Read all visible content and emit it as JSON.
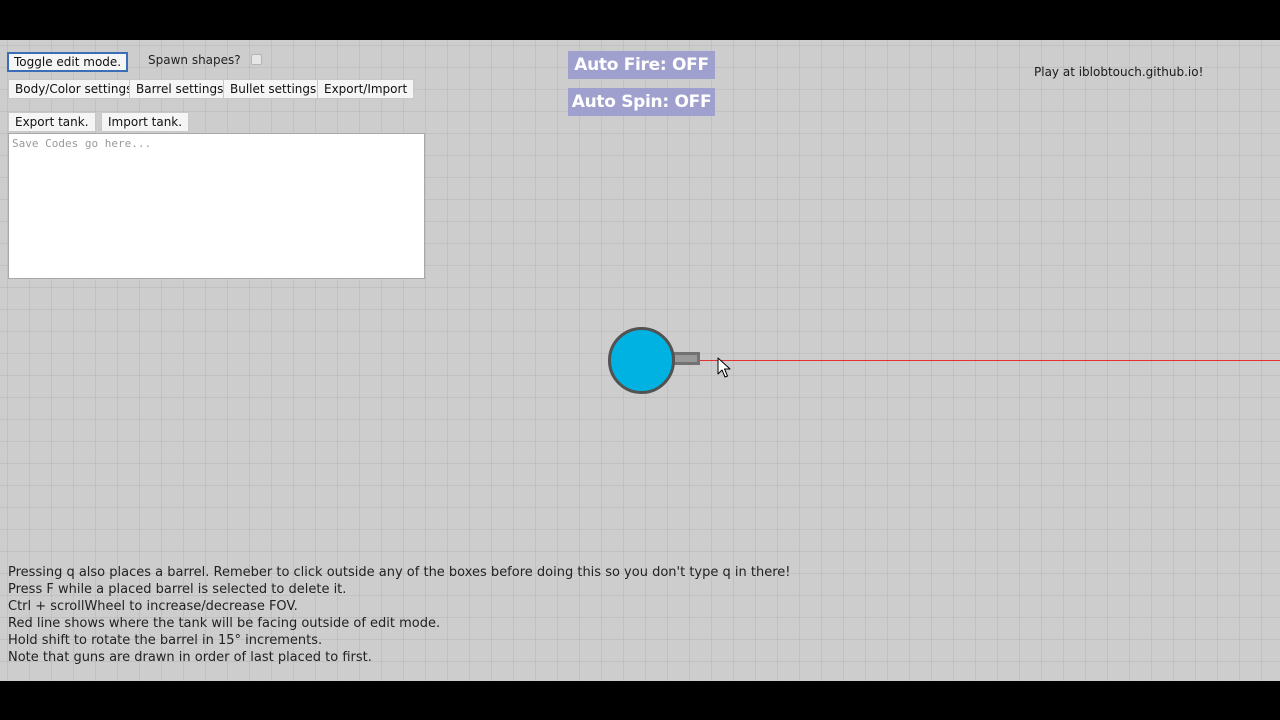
{
  "buttons": {
    "toggle_edit": "Toggle edit mode.",
    "body_color": "Body/Color settings",
    "barrel": "Barrel settings",
    "bullet": "Bullet settings",
    "export_import": "Export/Import",
    "export_tank": "Export tank.",
    "import_tank": "Import tank."
  },
  "spawn_shapes": {
    "label": "Spawn shapes?",
    "checked": false
  },
  "save_codes": {
    "placeholder": "Save Codes go here...",
    "value": ""
  },
  "toggles": {
    "auto_fire": "Auto Fire: OFF",
    "auto_spin": "Auto Spin: OFF"
  },
  "play_link": "Play at iblobtouch.github.io!",
  "instructions": [
    "Pressing q also places a barrel. Remeber to click outside any of the boxes before doing this so you don't type q in there!",
    "Press F while a placed barrel is selected to delete it.",
    "Ctrl + scrollWheel to increase/decrease FOV.",
    "Red line shows where the tank will be facing outside of edit mode.",
    "Hold shift to rotate the barrel in 15° increments.",
    "Note that guns are drawn in order of last placed to first."
  ],
  "colors": {
    "background": "#cdcdcd",
    "tank_body": "#00b2e1",
    "tank_outline": "#525252",
    "barrel_fill": "#999999",
    "barrel_outline": "#727272",
    "aim_line": "#e03030",
    "toggle_bg": "#a0a0cf"
  },
  "icons": {
    "cursor": "arrow-cursor-icon"
  }
}
